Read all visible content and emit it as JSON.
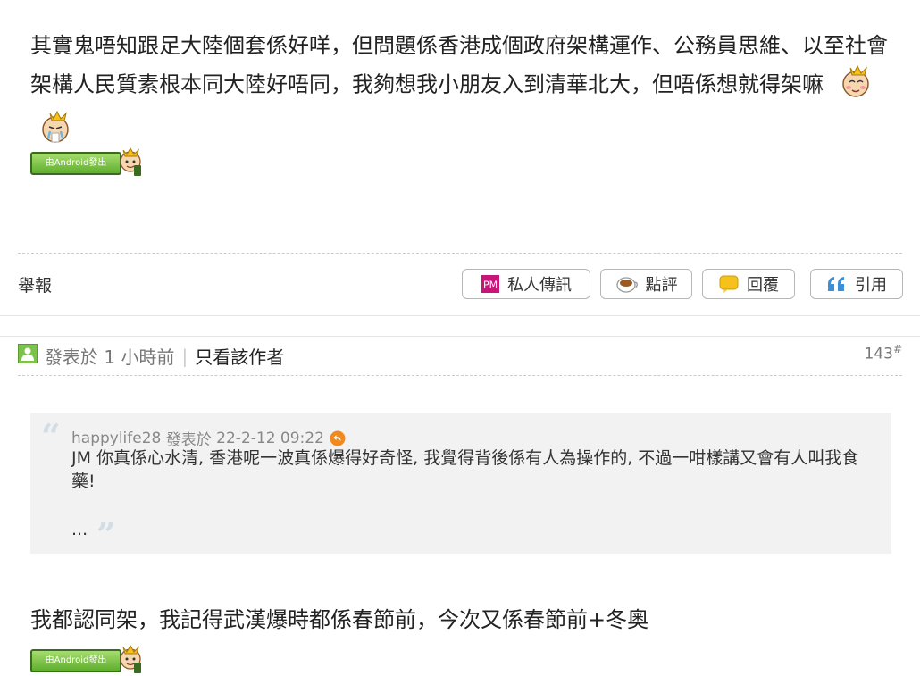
{
  "post1": {
    "body": "其實鬼唔知跟足大陸個套係好咩，但問題係香港成個政府架構運作、公務員思維、以至社會架構人民質素根本同大陸好唔同，我夠想我小朋友入到清華北大，但唔係想就得架嘛",
    "android_badge": "由Android發出"
  },
  "actions": {
    "report": "舉報",
    "pm": "私人傳訊",
    "pm_icon_text": "PM",
    "rate": "點評",
    "reply": "回覆",
    "quote": "引用"
  },
  "post2": {
    "meta": "發表於 1 小時前",
    "separator": "|",
    "author_only": "只看該作者",
    "floor": "143",
    "floor_suffix": "#",
    "quote": {
      "author": "happylife28",
      "posted_label": "發表於",
      "datetime": "22-2-12 09:22",
      "text": "JM 你真係心水清, 香港呢一波真係爆得好奇怪, 我覺得背後係有人為操作的, 不過一咁樣講又會有人叫我食藥!",
      "ellipsis": "...",
      "open_mark": "“",
      "close_mark": "”"
    },
    "body": "我都認同架，我記得武漢爆時都係春節前，今次又係春節前+冬奧",
    "android_badge": "由Android發出"
  },
  "colors": {
    "accent_green": "#7cc34a",
    "pm_magenta": "#c8157a",
    "reply_yellow": "#f6c11a",
    "quote_blue": "#3a8fd8",
    "jump_orange": "#f08a1f"
  }
}
